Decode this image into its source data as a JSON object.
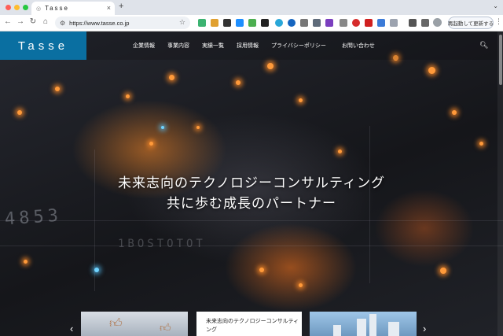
{
  "browser": {
    "tab_title": "Tasse",
    "url": "https://www.tasse.co.jp",
    "relaunch_label": "再起動して更新する",
    "new_tab_symbol": "+",
    "tab_close_symbol": "×",
    "back_symbol": "←",
    "forward_symbol": "→",
    "reload_symbol": "↻",
    "home_symbol": "⌂",
    "menu_symbol": "⋮",
    "tab_list_symbol": "⌄"
  },
  "site": {
    "logo": "Tasse",
    "nav": [
      "企業情報",
      "事業内容",
      "実績一覧",
      "採用情報",
      "プライバシーポリシー",
      "お問い合わせ"
    ],
    "hero_line1": "未来志向のテクノロジーコンサルティング",
    "hero_line2": "共に歩む成長のパートナー",
    "card_title": "未来志向のテクノロジーコンサルティング",
    "prev_symbol": "‹",
    "next_symbol": "›"
  },
  "decor": {
    "numbers": "4853",
    "code": "1BOSTOTOT"
  },
  "colors": {
    "brand": "#0a6fa1",
    "accent_glow": "#ff9a3a"
  }
}
